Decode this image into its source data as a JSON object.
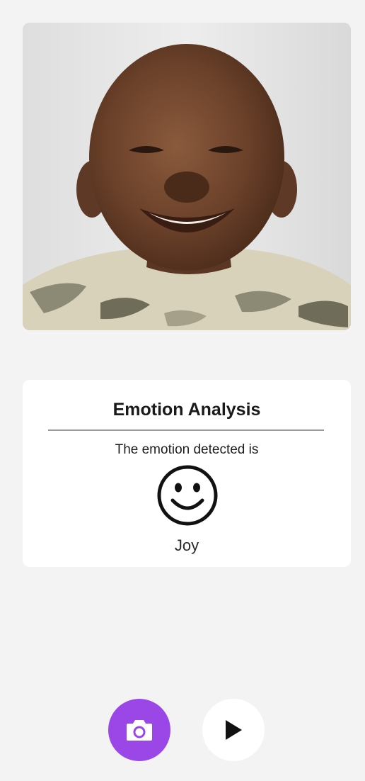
{
  "photo": {
    "icon": "smiling-child-photo"
  },
  "analysis": {
    "title": "Emotion Analysis",
    "subtitle": "The emotion detected is",
    "emotion_icon": "smiley-face-icon",
    "emotion_label": "Joy"
  },
  "controls": {
    "camera_icon": "camera-icon",
    "play_icon": "play-icon"
  },
  "colors": {
    "background": "#f3f3f3",
    "card": "#ffffff",
    "accent": "#9b47e8"
  }
}
